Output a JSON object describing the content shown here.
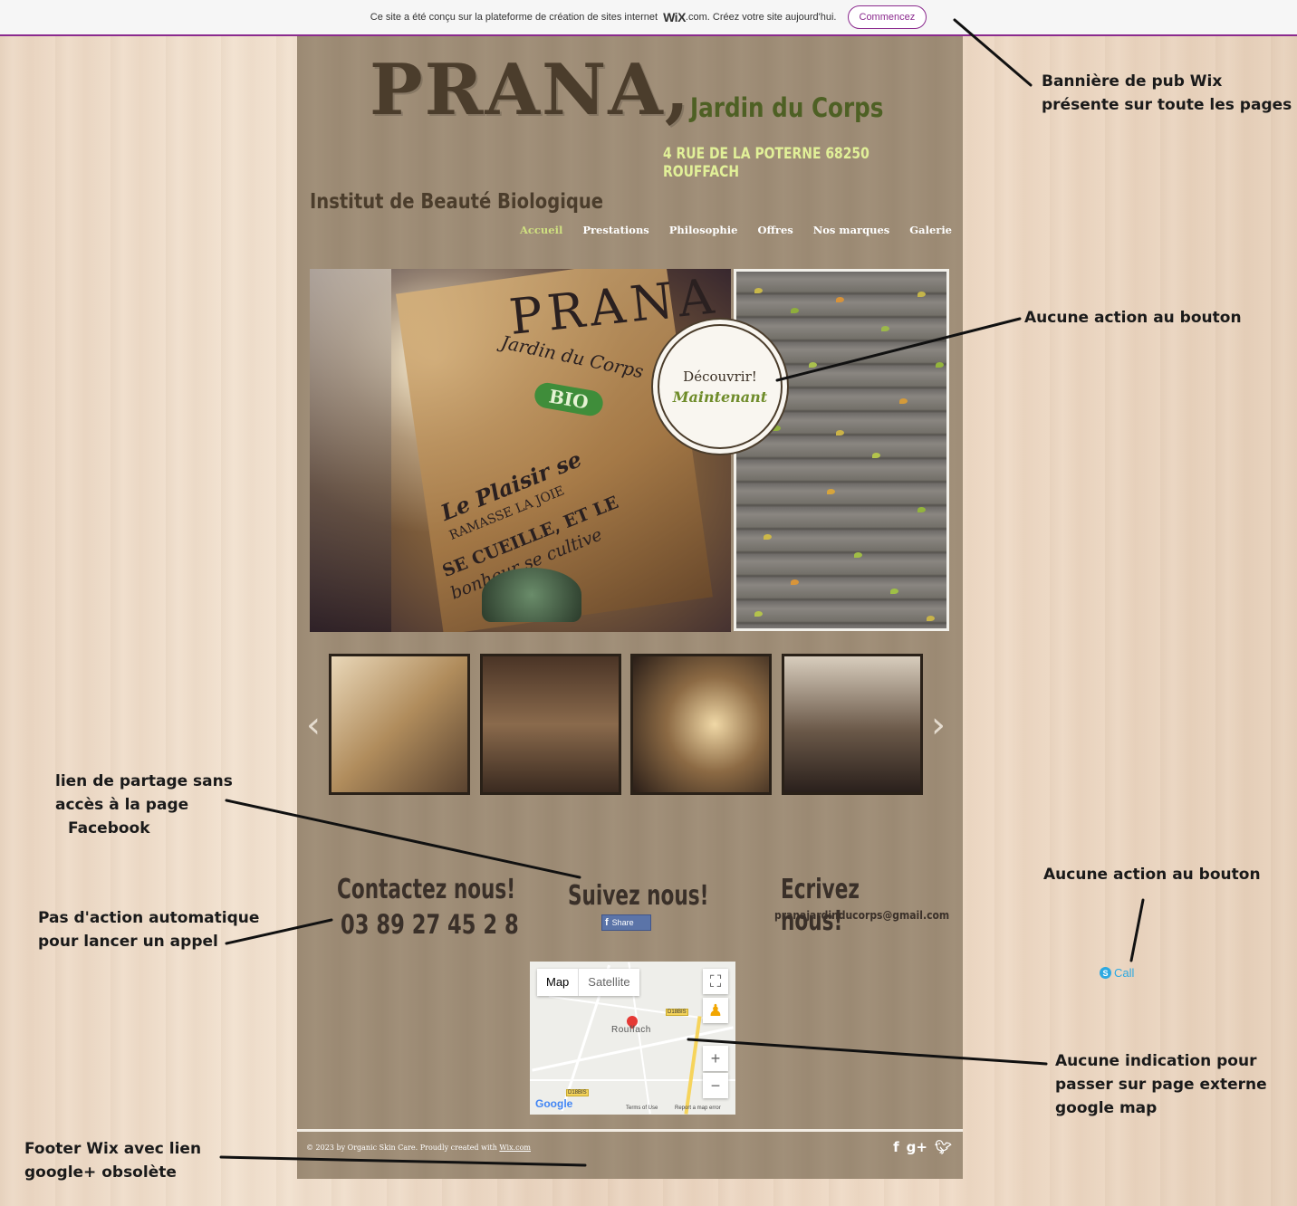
{
  "wix_banner": {
    "text": "Ce site a été conçu sur la plateforme de création de sites internet",
    "logo": "WiX",
    "suffix": ".com. Créez votre site aujourd'hui.",
    "button": "Commencez"
  },
  "header": {
    "logo": "PRANA,",
    "subtitle": "Jardin du Corps",
    "address": "4 RUE DE LA POTERNE 68250 ROUFFACH",
    "tagline": "Institut de Beauté Biologique"
  },
  "nav": [
    "Accueil",
    "Prestations",
    "Philosophie",
    "Offres",
    "Nos marques",
    "Galerie"
  ],
  "hero": {
    "cta_line1": "Découvrir!",
    "cta_line2": "Maintenant",
    "card_brand": "PRANA",
    "card_sub": "Jardin du Corps",
    "card_badge": "BIO",
    "card_phrase1": "Le Plaisir se",
    "card_phrase2": "ramasse la joie",
    "card_phrase3": "se cueille, et le",
    "card_phrase4": "bonheur se cultive"
  },
  "gallery": {
    "prev": "‹",
    "next": "›"
  },
  "contact": {
    "heading_call": "Contactez nous!",
    "phone": "03 89 27 45 2 8",
    "heading_follow": "Suivez nous!",
    "share": "Share",
    "heading_write": "Ecrivez nous!",
    "email": "pranajardinducorps@gmail.com"
  },
  "map": {
    "tab_map": "Map",
    "tab_satellite": "Satellite",
    "city": "Rouffach",
    "road_tag1": "D18BIS",
    "road_tag2": "D18BIS",
    "google": "Google",
    "terms": "Terms of Use",
    "report": "Report a map error",
    "zoom_in": "+",
    "zoom_out": "−"
  },
  "footer": {
    "text": "© 2023 by Organic Skin Care. Proudly created with",
    "link": "Wix.com",
    "social": [
      "f",
      "g+",
      "t"
    ]
  },
  "annotations": {
    "banner_l1": "Bannière de pub Wix",
    "banner_l2": "présente sur toute les pages",
    "cta_note": "Aucune action au bouton",
    "share_l1": "lien de partage sans",
    "share_l2": "accès à la page",
    "share_l3": "Facebook",
    "phone_l1": "Pas d'action automatique",
    "phone_l2": "pour lancer un appel",
    "call_note": "Aucune action au bouton",
    "map_l1": "Aucune indication pour",
    "map_l2": "passer sur page externe",
    "map_l3": "google map",
    "footer_l1": "Footer Wix avec lien",
    "footer_l2": "google+ obsolète"
  },
  "skype": {
    "label": "Call"
  }
}
